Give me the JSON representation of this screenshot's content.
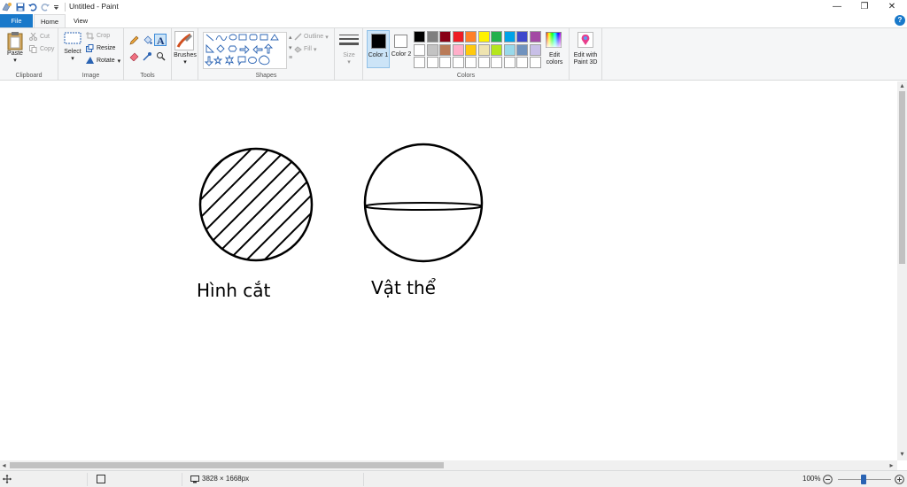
{
  "window": {
    "title": "Untitled - Paint",
    "minimize": "—",
    "restore": "❐",
    "close": "✕"
  },
  "tabs": {
    "file": "File",
    "home": "Home",
    "view": "View",
    "help": "?"
  },
  "ribbon": {
    "clipboard": {
      "paste": "Paste",
      "cut": "Cut",
      "copy": "Copy",
      "label": "Clipboard"
    },
    "image": {
      "select": "Select",
      "crop": "Crop",
      "resize": "Resize",
      "rotate": "Rotate",
      "label": "Image"
    },
    "tools": {
      "label": "Tools"
    },
    "brushes": {
      "label": "Brushes"
    },
    "shapes": {
      "outline": "Outline",
      "fill": "Fill",
      "label": "Shapes"
    },
    "size": {
      "label": "Size"
    },
    "colors": {
      "color1": "Color 1",
      "color2": "Color 2",
      "edit_colors": "Edit colors",
      "paint3d": "Edit with Paint 3D",
      "label": "Colors",
      "color1_value": "#000000",
      "color2_value": "#ffffff",
      "swatches": [
        "#000000",
        "#7f7f7f",
        "#880015",
        "#ed1c24",
        "#ff7f27",
        "#fff200",
        "#22b14c",
        "#00a2e8",
        "#3f48cc",
        "#a349a4",
        "#ffffff",
        "#c3c3c3",
        "#b97a57",
        "#ffaec9",
        "#ffc90e",
        "#efe4b0",
        "#b5e61d",
        "#99d9ea",
        "#7092be",
        "#c8bfe7",
        "#ffffff",
        "#ffffff",
        "#ffffff",
        "#ffffff",
        "#ffffff",
        "#ffffff",
        "#ffffff",
        "#ffffff",
        "#ffffff",
        "#ffffff"
      ]
    }
  },
  "drawing": {
    "label_left": "Hình cắt",
    "label_right": "Vật thể"
  },
  "status": {
    "dimensions": "3828 × 1668px",
    "zoom": "100%"
  }
}
